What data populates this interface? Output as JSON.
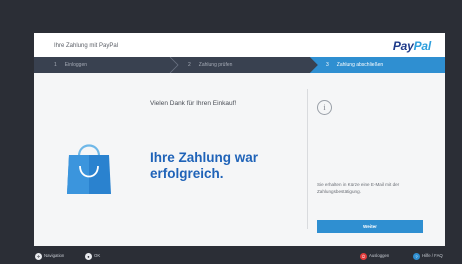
{
  "header": {
    "title": "Ihre Zahlung mit PayPal",
    "logo_left": "Pay",
    "logo_right": "Pal"
  },
  "steps": [
    {
      "number": "1",
      "label": "Einloggen",
      "state": "done"
    },
    {
      "number": "2",
      "label": "Zahlung prüfen",
      "state": "done"
    },
    {
      "number": "3",
      "label": "Zahlung abschließen",
      "state": "active"
    }
  ],
  "main": {
    "thanks": "Vielen Dank für Ihren Einkauf!",
    "success": "Ihre Zahlung war erfolgreich."
  },
  "side": {
    "info_icon_glyph": "i",
    "email_note": "Sie erhalten in Kürze eine E-Mail mit der Zahlungsbestätigung.",
    "next_button": "Weiter"
  },
  "footer": {
    "navigate": "Navigation",
    "ok": "OK",
    "exit": "Ausloggen",
    "help": "Hilfe / FAQ"
  },
  "colors": {
    "accent": "#2f8fd1",
    "success_text": "#1f63b8",
    "background": "#2b2e36",
    "exit": "#e23b3b"
  },
  "icons": {
    "bag": "shopping-bag-icon",
    "info": "info-icon",
    "navigate": "navigation-icon",
    "ok": "ok-icon",
    "exit": "exit-icon",
    "help": "help-icon"
  }
}
